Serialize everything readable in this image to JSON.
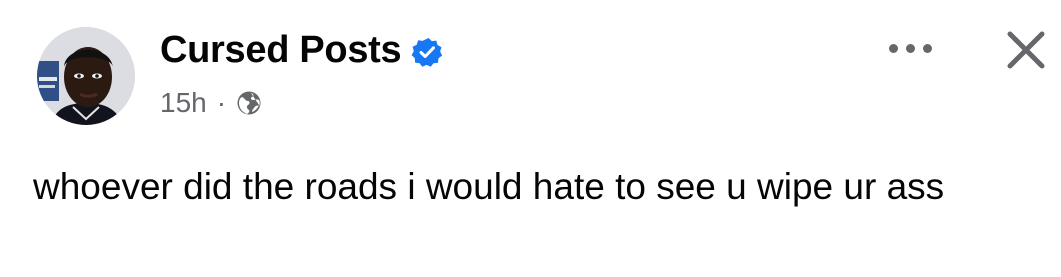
{
  "post": {
    "author": "Cursed Posts",
    "verified": true,
    "timestamp": "15h",
    "separator": "·",
    "audience_icon": "globe-icon",
    "text": "whoever did the roads i would hate to see u wipe ur ass"
  },
  "icons": {
    "verified": "verified-badge-icon",
    "more": "more-options-icon",
    "close": "close-icon"
  },
  "colors": {
    "verified_badge": "#1877f2",
    "secondary_text": "#65676b",
    "primary_text": "#050505"
  }
}
